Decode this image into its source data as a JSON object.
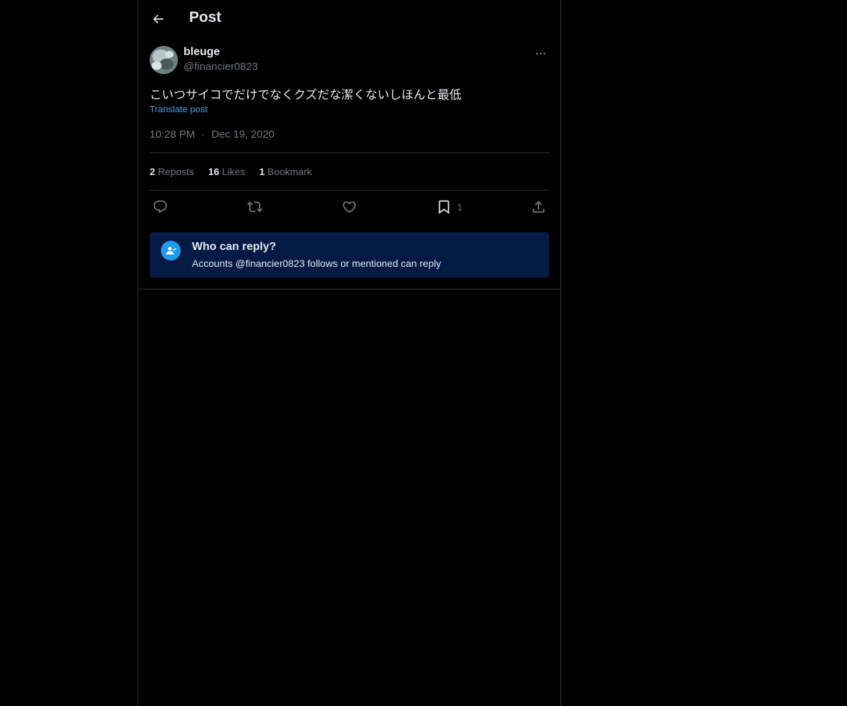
{
  "header": {
    "title": "Post",
    "back_icon": "arrow-left-icon"
  },
  "post": {
    "author": {
      "display_name": "bleuge",
      "handle": "@financier0823"
    },
    "text": "こいつサイコでだけでなくクズだな潔くないしほんと最低",
    "translate_label": "Translate post",
    "time": "10:28 PM",
    "separator": "·",
    "date": "Dec 19, 2020",
    "stats": {
      "reposts_count": "2",
      "reposts_label": "Reposts",
      "likes_count": "16",
      "likes_label": "Likes",
      "bookmarks_count": "1",
      "bookmarks_label": "Bookmark"
    },
    "actions": {
      "bookmark_count": "1"
    }
  },
  "reply_restriction": {
    "title": "Who can reply?",
    "description": "Accounts @financier0823 follows or mentioned can reply"
  },
  "colors": {
    "background": "#000000",
    "text_primary": "#e7e9ea",
    "text_secondary": "#71767b",
    "link": "#4c9eeb",
    "accent": "#1d9bf0",
    "info_box": "#061a46",
    "border": "#2f3336"
  }
}
